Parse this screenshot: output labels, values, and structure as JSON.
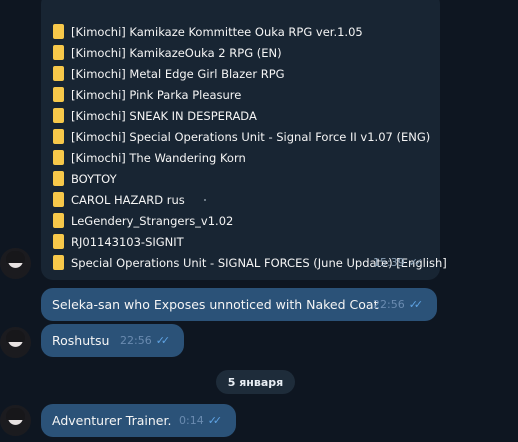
{
  "files_message": {
    "files": [
      "[Kimochi] Kamikaze Kommittee Ouka RPG ver.1.05",
      "[Kimochi] KamikazeOuka 2 RPG (EN)",
      "[Kimochi] Metal Edge Girl Blazer RPG",
      "[Kimochi] Pink Parka Pleasure",
      "[Kimochi] SNEAK IN DESPERADA",
      "[Kimochi] Special Operations Unit - Signal Force II v1.07 (ENG)",
      "[Kimochi] The Wandering Korn",
      "BOYTOY",
      "CAROL HAZARD rus",
      "LeGendery_Strangers_v1.02",
      "RJ01143103-SIGNIT",
      "Special Operations Unit - SIGNAL FORCES (June Update) [English]"
    ],
    "time": "15:39",
    "icon": "folder-icon"
  },
  "messages": [
    {
      "text": "Seleka-san who Exposes unnoticed with Naked Coat",
      "time": "22:56"
    },
    {
      "text": "Roshutsu",
      "time": "22:56"
    },
    {
      "text": "Adventurer Trainer.",
      "time": "0:14"
    }
  ],
  "date_separator": "5 января",
  "colors": {
    "background": "#0e1621",
    "incoming_bubble": "#182533",
    "outgoing_bubble": "#2b5278",
    "read_ticks": "#5ea2e2"
  }
}
